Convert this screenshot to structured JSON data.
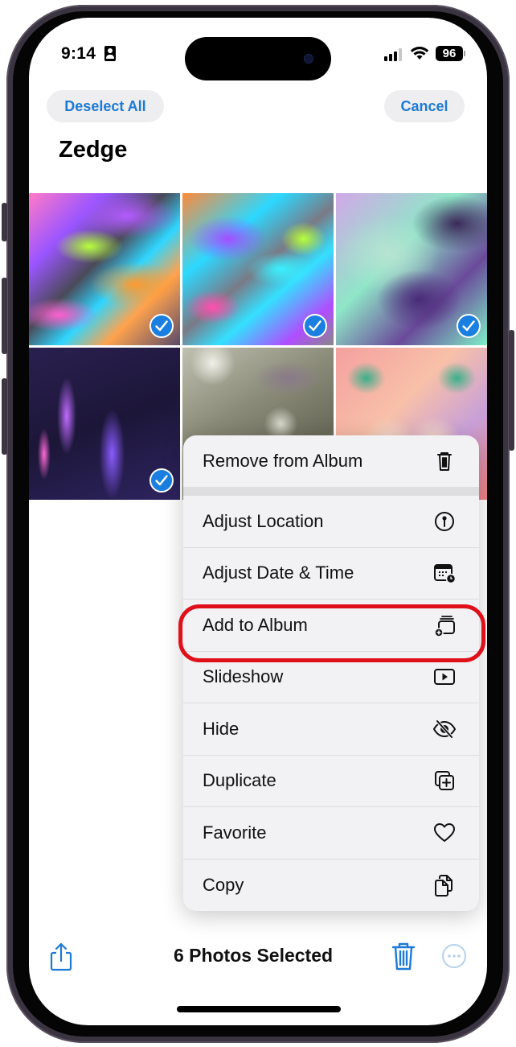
{
  "status_bar": {
    "time": "9:14",
    "battery": "96",
    "icons": [
      "contact-card-icon",
      "signal-icon",
      "wifi-icon",
      "battery-icon"
    ]
  },
  "nav": {
    "deselect_label": "Deselect All",
    "cancel_label": "Cancel",
    "title": "Zedge"
  },
  "photos": [
    {
      "name": "iridescent-swirl-1",
      "selected": true
    },
    {
      "name": "iridescent-swirl-2",
      "selected": true
    },
    {
      "name": "purple-mint-fluid",
      "selected": true
    },
    {
      "name": "dark-purple-smoke",
      "selected": true
    },
    {
      "name": "nebula-galaxy",
      "selected": false
    },
    {
      "name": "kaleidoscope-pattern",
      "selected": false
    }
  ],
  "menu": {
    "items": [
      {
        "label": "Remove from Album",
        "icon": "trash-icon"
      },
      {
        "label": "Adjust Location",
        "icon": "location-pin-icon"
      },
      {
        "label": "Adjust Date & Time",
        "icon": "calendar-clock-icon"
      },
      {
        "label": "Add to Album",
        "icon": "add-to-album-icon",
        "highlighted": true
      },
      {
        "label": "Slideshow",
        "icon": "play-icon"
      },
      {
        "label": "Hide",
        "icon": "eye-slash-icon"
      },
      {
        "label": "Duplicate",
        "icon": "duplicate-icon"
      },
      {
        "label": "Favorite",
        "icon": "heart-icon"
      },
      {
        "label": "Copy",
        "icon": "copy-icon"
      }
    ]
  },
  "toolbar": {
    "selection_count": "6 Photos Selected",
    "share_icon": "share-icon",
    "trash_icon": "trash-icon",
    "more_icon": "ellipsis-circle-icon"
  },
  "colors": {
    "accent": "#1c7ad6",
    "highlight_ring": "#e0101a",
    "check_badge": "#1a7fe0"
  }
}
